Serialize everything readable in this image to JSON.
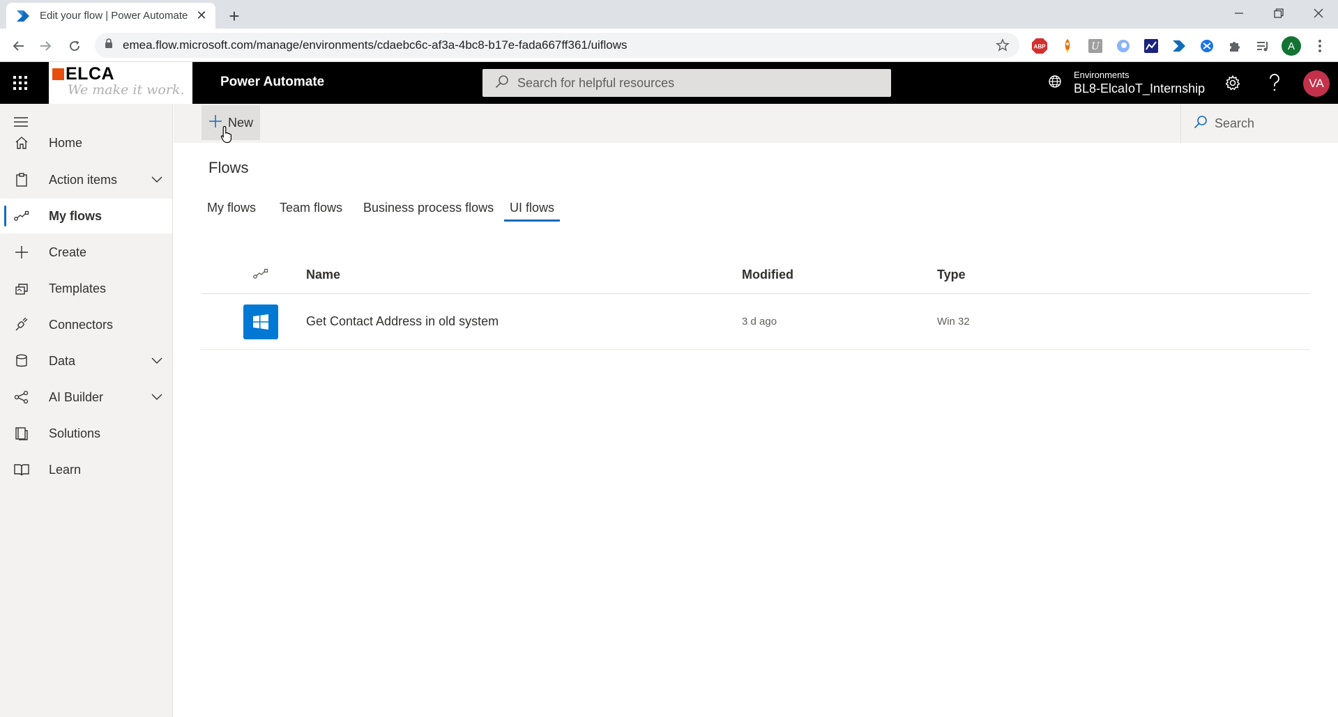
{
  "browser": {
    "tab_title": "Edit your flow | Power Automate",
    "url": "emea.flow.microsoft.com/manage/environments/cdaebc6c-af3a-4bc8-b17e-fada667ff361/uiflows",
    "profile_initial": "A",
    "extension_abp": "ABP"
  },
  "header": {
    "logo_text": "ELCA",
    "logo_tagline": "We make it work.",
    "app_name": "Power Automate",
    "search_placeholder": "Search for helpful resources",
    "environment_label": "Environments",
    "environment_name": "BL8-ElcaIoT_Internship",
    "user_initials": "VA",
    "brand_color": "#0f6cbd",
    "avatar_color": "#c4314b"
  },
  "nav": {
    "items": [
      {
        "label": "Home",
        "icon": "home-icon"
      },
      {
        "label": "Action items",
        "icon": "clipboard-icon",
        "expandable": true
      },
      {
        "label": "My flows",
        "icon": "flow-icon",
        "active": true
      },
      {
        "label": "Create",
        "icon": "plus-icon"
      },
      {
        "label": "Templates",
        "icon": "templates-icon"
      },
      {
        "label": "Connectors",
        "icon": "connector-icon"
      },
      {
        "label": "Data",
        "icon": "database-icon",
        "expandable": true
      },
      {
        "label": "AI Builder",
        "icon": "ai-builder-icon",
        "expandable": true
      },
      {
        "label": "Solutions",
        "icon": "solutions-icon"
      },
      {
        "label": "Learn",
        "icon": "book-icon"
      }
    ]
  },
  "commandbar": {
    "new_label": "New",
    "search_placeholder": "Search"
  },
  "main": {
    "title": "Flows",
    "tabs": [
      {
        "label": "My flows"
      },
      {
        "label": "Team flows"
      },
      {
        "label": "Business process flows"
      },
      {
        "label": "UI flows",
        "active": true
      }
    ],
    "table": {
      "columns": [
        "Name",
        "Modified",
        "Type"
      ],
      "rows": [
        {
          "name": "Get Contact Address in old system",
          "modified": "3 d ago",
          "type": "Win 32",
          "icon": "windows-icon"
        }
      ]
    }
  }
}
